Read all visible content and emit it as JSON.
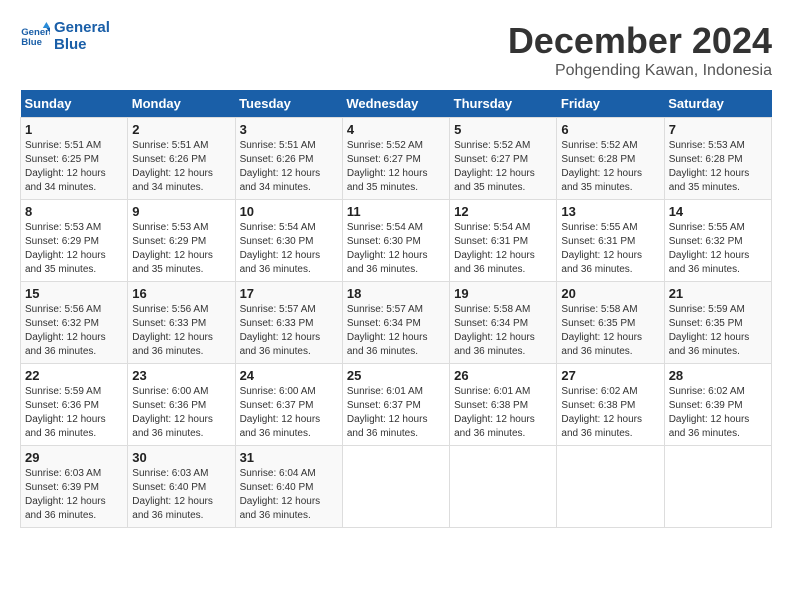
{
  "logo": {
    "line1": "General",
    "line2": "Blue"
  },
  "title": "December 2024",
  "subtitle": "Pohgending Kawan, Indonesia",
  "days_of_week": [
    "Sunday",
    "Monday",
    "Tuesday",
    "Wednesday",
    "Thursday",
    "Friday",
    "Saturday"
  ],
  "weeks": [
    [
      {
        "day": "1",
        "info": "Sunrise: 5:51 AM\nSunset: 6:25 PM\nDaylight: 12 hours\nand 34 minutes."
      },
      {
        "day": "2",
        "info": "Sunrise: 5:51 AM\nSunset: 6:26 PM\nDaylight: 12 hours\nand 34 minutes."
      },
      {
        "day": "3",
        "info": "Sunrise: 5:51 AM\nSunset: 6:26 PM\nDaylight: 12 hours\nand 34 minutes."
      },
      {
        "day": "4",
        "info": "Sunrise: 5:52 AM\nSunset: 6:27 PM\nDaylight: 12 hours\nand 35 minutes."
      },
      {
        "day": "5",
        "info": "Sunrise: 5:52 AM\nSunset: 6:27 PM\nDaylight: 12 hours\nand 35 minutes."
      },
      {
        "day": "6",
        "info": "Sunrise: 5:52 AM\nSunset: 6:28 PM\nDaylight: 12 hours\nand 35 minutes."
      },
      {
        "day": "7",
        "info": "Sunrise: 5:53 AM\nSunset: 6:28 PM\nDaylight: 12 hours\nand 35 minutes."
      }
    ],
    [
      {
        "day": "8",
        "info": "Sunrise: 5:53 AM\nSunset: 6:29 PM\nDaylight: 12 hours\nand 35 minutes."
      },
      {
        "day": "9",
        "info": "Sunrise: 5:53 AM\nSunset: 6:29 PM\nDaylight: 12 hours\nand 35 minutes."
      },
      {
        "day": "10",
        "info": "Sunrise: 5:54 AM\nSunset: 6:30 PM\nDaylight: 12 hours\nand 36 minutes."
      },
      {
        "day": "11",
        "info": "Sunrise: 5:54 AM\nSunset: 6:30 PM\nDaylight: 12 hours\nand 36 minutes."
      },
      {
        "day": "12",
        "info": "Sunrise: 5:54 AM\nSunset: 6:31 PM\nDaylight: 12 hours\nand 36 minutes."
      },
      {
        "day": "13",
        "info": "Sunrise: 5:55 AM\nSunset: 6:31 PM\nDaylight: 12 hours\nand 36 minutes."
      },
      {
        "day": "14",
        "info": "Sunrise: 5:55 AM\nSunset: 6:32 PM\nDaylight: 12 hours\nand 36 minutes."
      }
    ],
    [
      {
        "day": "15",
        "info": "Sunrise: 5:56 AM\nSunset: 6:32 PM\nDaylight: 12 hours\nand 36 minutes."
      },
      {
        "day": "16",
        "info": "Sunrise: 5:56 AM\nSunset: 6:33 PM\nDaylight: 12 hours\nand 36 minutes."
      },
      {
        "day": "17",
        "info": "Sunrise: 5:57 AM\nSunset: 6:33 PM\nDaylight: 12 hours\nand 36 minutes."
      },
      {
        "day": "18",
        "info": "Sunrise: 5:57 AM\nSunset: 6:34 PM\nDaylight: 12 hours\nand 36 minutes."
      },
      {
        "day": "19",
        "info": "Sunrise: 5:58 AM\nSunset: 6:34 PM\nDaylight: 12 hours\nand 36 minutes."
      },
      {
        "day": "20",
        "info": "Sunrise: 5:58 AM\nSunset: 6:35 PM\nDaylight: 12 hours\nand 36 minutes."
      },
      {
        "day": "21",
        "info": "Sunrise: 5:59 AM\nSunset: 6:35 PM\nDaylight: 12 hours\nand 36 minutes."
      }
    ],
    [
      {
        "day": "22",
        "info": "Sunrise: 5:59 AM\nSunset: 6:36 PM\nDaylight: 12 hours\nand 36 minutes."
      },
      {
        "day": "23",
        "info": "Sunrise: 6:00 AM\nSunset: 6:36 PM\nDaylight: 12 hours\nand 36 minutes."
      },
      {
        "day": "24",
        "info": "Sunrise: 6:00 AM\nSunset: 6:37 PM\nDaylight: 12 hours\nand 36 minutes."
      },
      {
        "day": "25",
        "info": "Sunrise: 6:01 AM\nSunset: 6:37 PM\nDaylight: 12 hours\nand 36 minutes."
      },
      {
        "day": "26",
        "info": "Sunrise: 6:01 AM\nSunset: 6:38 PM\nDaylight: 12 hours\nand 36 minutes."
      },
      {
        "day": "27",
        "info": "Sunrise: 6:02 AM\nSunset: 6:38 PM\nDaylight: 12 hours\nand 36 minutes."
      },
      {
        "day": "28",
        "info": "Sunrise: 6:02 AM\nSunset: 6:39 PM\nDaylight: 12 hours\nand 36 minutes."
      }
    ],
    [
      {
        "day": "29",
        "info": "Sunrise: 6:03 AM\nSunset: 6:39 PM\nDaylight: 12 hours\nand 36 minutes."
      },
      {
        "day": "30",
        "info": "Sunrise: 6:03 AM\nSunset: 6:40 PM\nDaylight: 12 hours\nand 36 minutes."
      },
      {
        "day": "31",
        "info": "Sunrise: 6:04 AM\nSunset: 6:40 PM\nDaylight: 12 hours\nand 36 minutes."
      },
      null,
      null,
      null,
      null
    ]
  ]
}
